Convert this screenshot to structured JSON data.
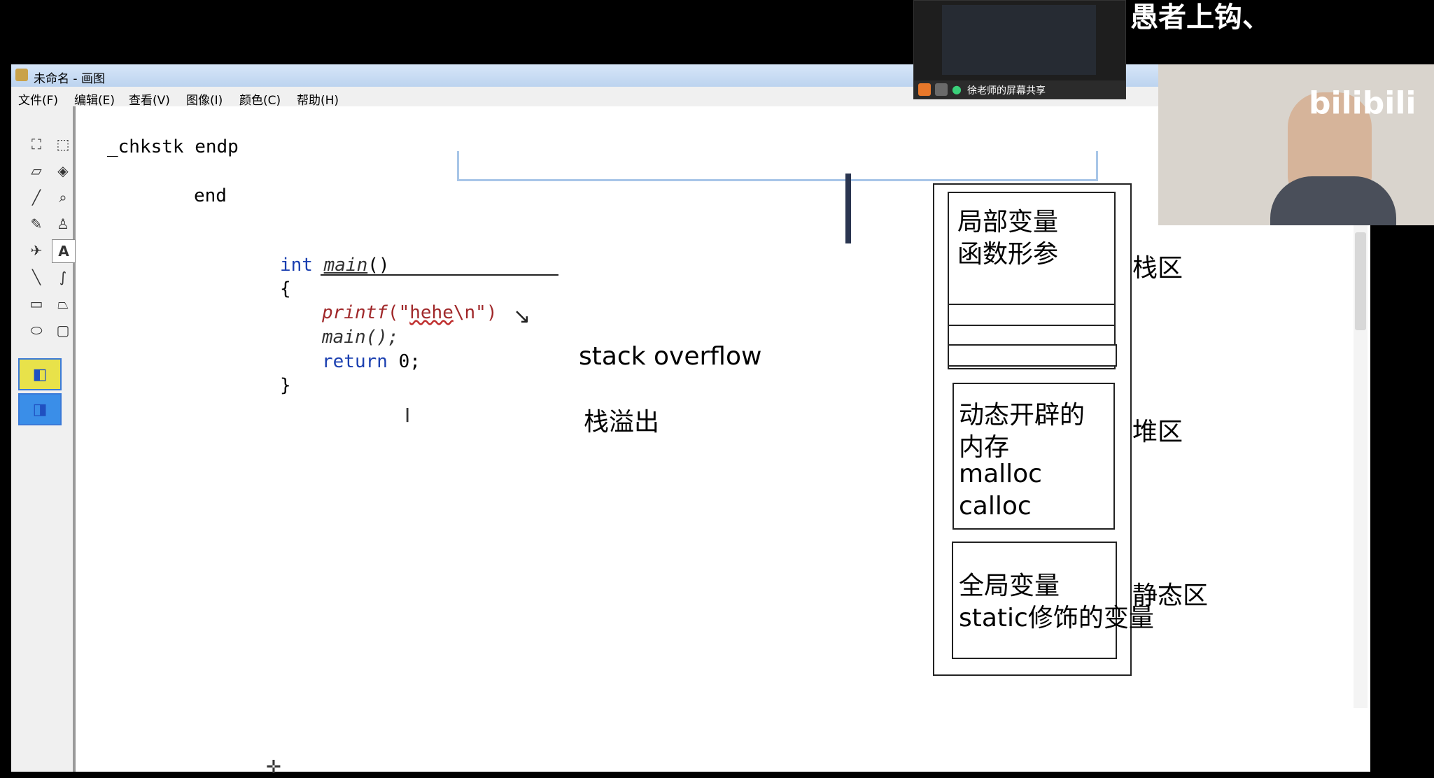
{
  "window": {
    "title": "未命名 - 画图",
    "menu": [
      "文件(F)",
      "编辑(E)",
      "查看(V)",
      "图像(I)",
      "颜色(C)",
      "帮助(H)"
    ]
  },
  "overlay": {
    "caption": "愚者上钩、",
    "screenshare_label": "徐老师的屏幕共享",
    "watermark": "bilibili"
  },
  "canvas": {
    "code": {
      "line1": "_chkstk endp",
      "line2": "end",
      "int_kw": "int",
      "main_fn": "main",
      "main_paren": "()",
      "brace_open": "{",
      "printf_fn": "printf",
      "printf_args_open": "(\"",
      "printf_str": "hehe",
      "printf_args_close": "\\n\")",
      "main_call": "main();",
      "return_kw": "return",
      "return_val": "0;",
      "brace_close": "}"
    },
    "notes": {
      "stack_overflow_en": "stack overflow",
      "stack_overflow_cn": "栈溢出"
    },
    "memory": {
      "stack_box_line1": "局部变量",
      "stack_box_line2": "函数形参",
      "stack_label": "栈区",
      "heap_box_line1": "动态开辟的",
      "heap_box_line2": "内存",
      "heap_box_line3": "malloc",
      "heap_box_line4": "calloc",
      "heap_label": "堆区",
      "static_box_line1": "全局变量",
      "static_box_line2": "static修饰的变量",
      "static_label": "静态区"
    }
  }
}
